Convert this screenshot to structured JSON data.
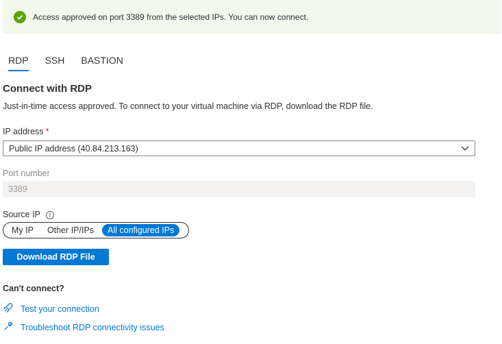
{
  "banner": {
    "message": "Access approved on port 3389 from the selected IPs. You can now connect."
  },
  "tabs": [
    {
      "label": "RDP",
      "active": true
    },
    {
      "label": "SSH",
      "active": false
    },
    {
      "label": "BASTION",
      "active": false
    }
  ],
  "section": {
    "title": "Connect with RDP",
    "description": "Just-in-time access approved. To connect to your virtual machine via RDP, download the RDP file."
  },
  "ip_address": {
    "label": "IP address",
    "required_marker": "*",
    "value": "Public IP address (40.84.213.163)"
  },
  "port": {
    "label": "Port number",
    "value": "3389"
  },
  "source_ip": {
    "label": "Source IP",
    "options": [
      "My IP",
      "Other IP/IPs",
      "All configured IPs"
    ],
    "selected": "All configured IPs"
  },
  "download_button": {
    "label": "Download RDP File"
  },
  "cant_connect": {
    "title": "Can't connect?",
    "links": [
      {
        "label": "Test your connection",
        "icon": "rocket-icon"
      },
      {
        "label": "Troubleshoot RDP connectivity issues",
        "icon": "wrench-icon"
      }
    ]
  },
  "colors": {
    "accent": "#0078d4",
    "success": "#57a300",
    "banner_bg": "#f1f8ec",
    "required": "#a4262c"
  }
}
